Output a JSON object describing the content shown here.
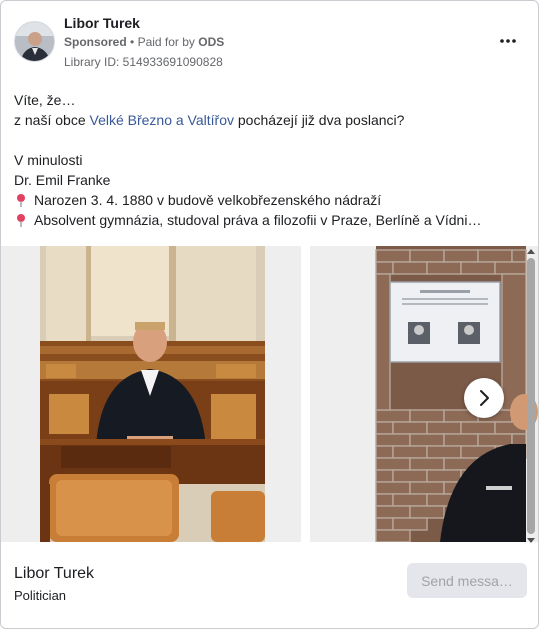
{
  "post": {
    "page_name": "Libor Turek",
    "sponsored": "Sponsored",
    "separator": "•",
    "paid_for_prefix": "Paid for by",
    "paid_for_by": "ODS",
    "library_id": "Library ID: 514933691090828",
    "more_icon": "more-horizontal-icon"
  },
  "body": {
    "line1": "Víte, že…",
    "line2_prefix": "z naší obce ",
    "line2_link": "Velké Březno a Valtířov",
    "line2_suffix": " pocházejí již dva poslanci?",
    "line3": "V minulosti",
    "line4": "Dr. Emil Franke",
    "bullet_icon": "pushpin-icon",
    "bullet1": "Narozen 3. 4. 1880 v budově velkobřezenského nádraží",
    "bullet2": "Absolvent gymnázia, studoval práva a filozofii v Praze, Berlíně a Vídni…"
  },
  "carousel": {
    "next_icon": "chevron-right-icon",
    "scroll_up_icon": "scroll-up-arrow-icon",
    "scroll_down_icon": "scroll-down-arrow-icon"
  },
  "footer": {
    "title": "Libor Turek",
    "subtitle": "Politician",
    "button_label": "Send messa…"
  },
  "colors": {
    "link": "#385898",
    "secondary_text": "#65676b",
    "button_bg": "#e4e6eb",
    "pin": "#e4405f"
  }
}
